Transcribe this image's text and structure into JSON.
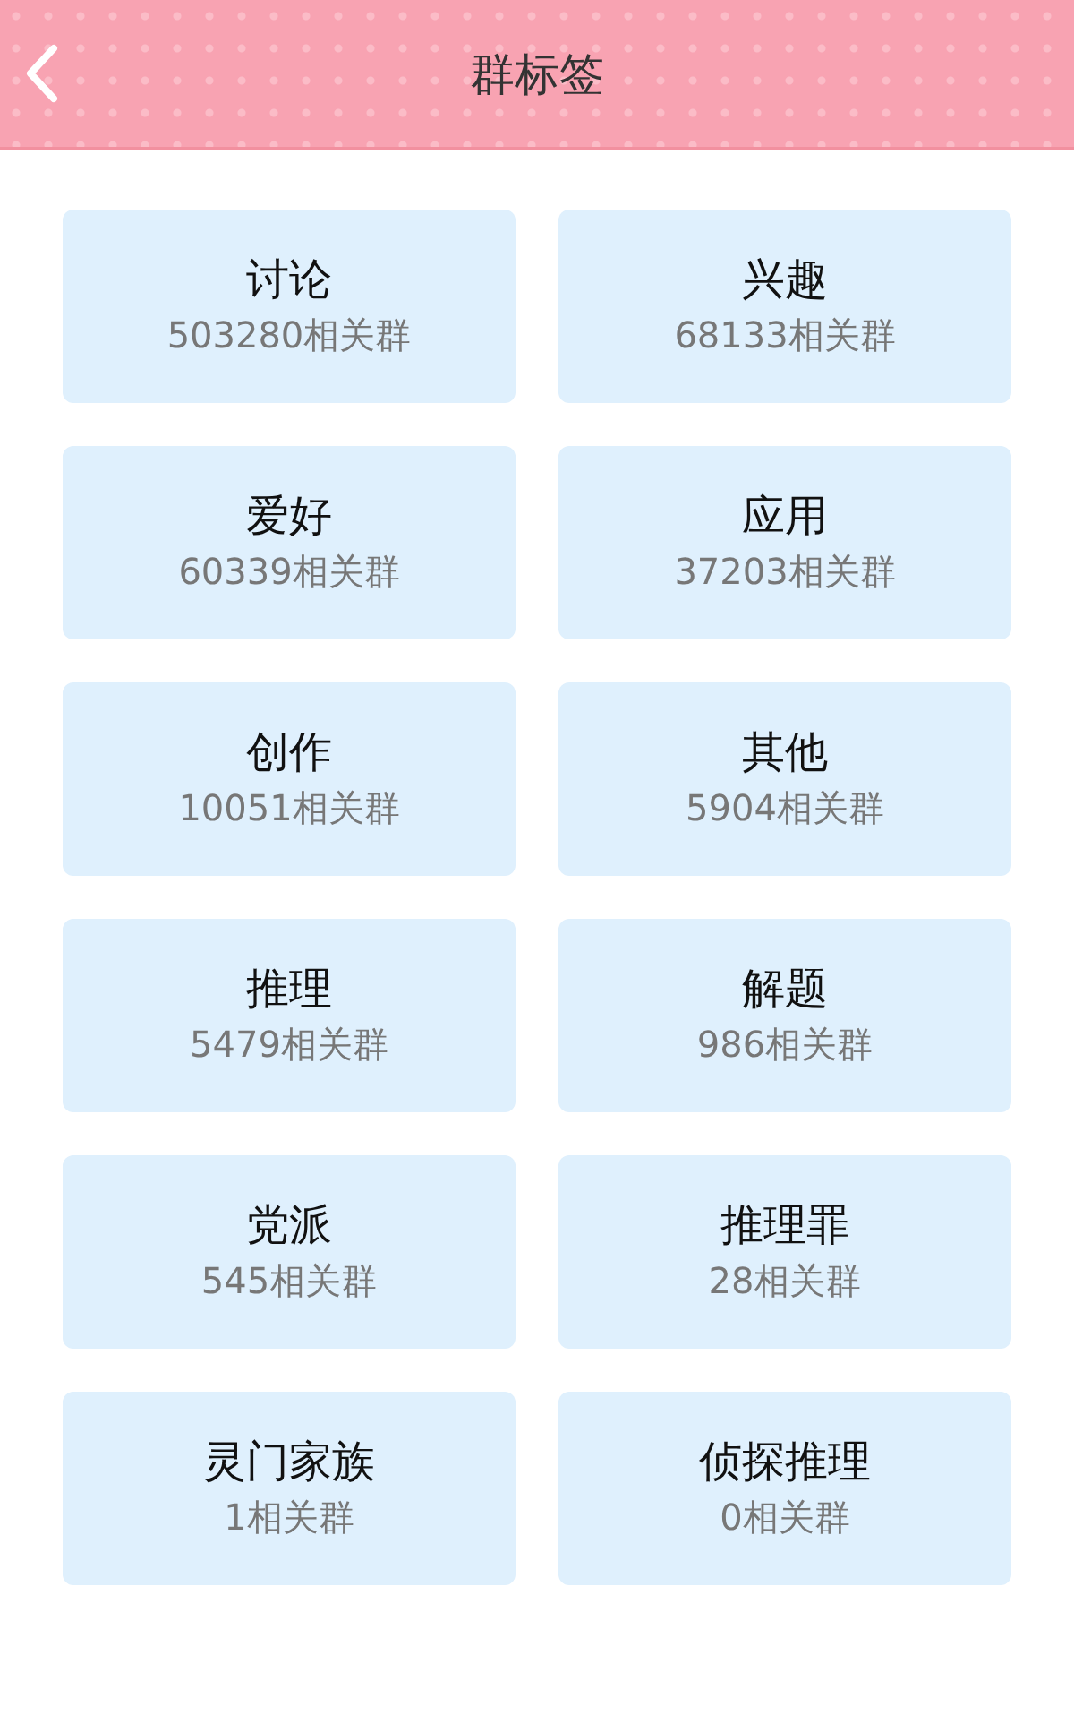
{
  "header": {
    "title": "群标签"
  },
  "tags": [
    {
      "name": "讨论",
      "count": "503280相关群"
    },
    {
      "name": "兴趣",
      "count": "68133相关群"
    },
    {
      "name": "爱好",
      "count": "60339相关群"
    },
    {
      "name": "应用",
      "count": "37203相关群"
    },
    {
      "name": "创作",
      "count": "10051相关群"
    },
    {
      "name": "其他",
      "count": "5904相关群"
    },
    {
      "name": "推理",
      "count": "5479相关群"
    },
    {
      "name": "解题",
      "count": "986相关群"
    },
    {
      "name": "党派",
      "count": "545相关群"
    },
    {
      "name": "推理罪",
      "count": "28相关群"
    },
    {
      "name": "灵门家族",
      "count": "1相关群"
    },
    {
      "name": "侦探推理",
      "count": "0相关群"
    }
  ]
}
